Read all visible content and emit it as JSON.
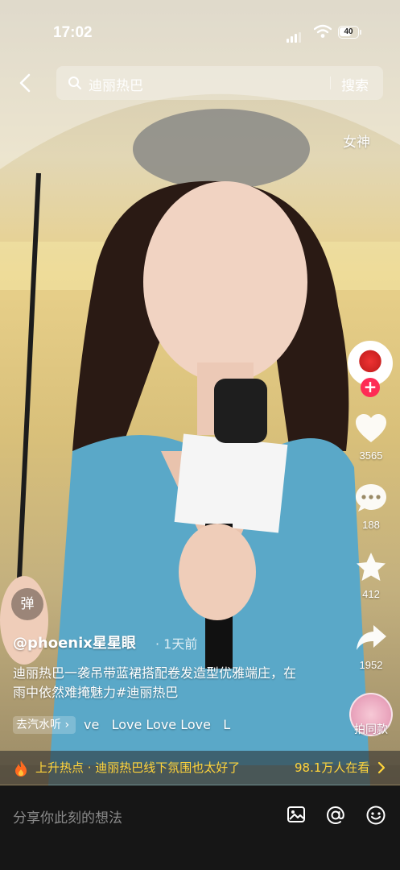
{
  "status_bar": {
    "time": "17:02",
    "battery": "40"
  },
  "search": {
    "query": "迪丽热巴",
    "button_label": "搜索"
  },
  "topic_tag": "女神",
  "actions": {
    "like_count": "3565",
    "comment_count": "188",
    "favorite_count": "412",
    "share_count": "1952",
    "music_label": "拍同款"
  },
  "danmu_label": "弹",
  "post": {
    "author": "@phoenix星星眼",
    "time": "· 1天前",
    "caption": "迪丽热巴一袭吊带蓝裙搭配卷发造型优雅端庄，在雨中依然难掩魅力#迪丽热巴",
    "music_chip": "去汽水听",
    "music_title": "ve   Love Love Love   L"
  },
  "hot": {
    "text": "上升热点 · 迪丽热巴线下氛围也太好了",
    "count": "98.1万人在看"
  },
  "comment_placeholder": "分享你此刻的想法",
  "colors": {
    "hot_text": "#ffd43b",
    "follow": "#fe2c55",
    "bottom_bar": "#161616"
  },
  "icons": [
    "back-icon",
    "search-icon",
    "heart-icon",
    "comment-icon",
    "star-icon",
    "share-icon",
    "fire-icon",
    "image-icon",
    "at-icon",
    "emoji-icon"
  ]
}
